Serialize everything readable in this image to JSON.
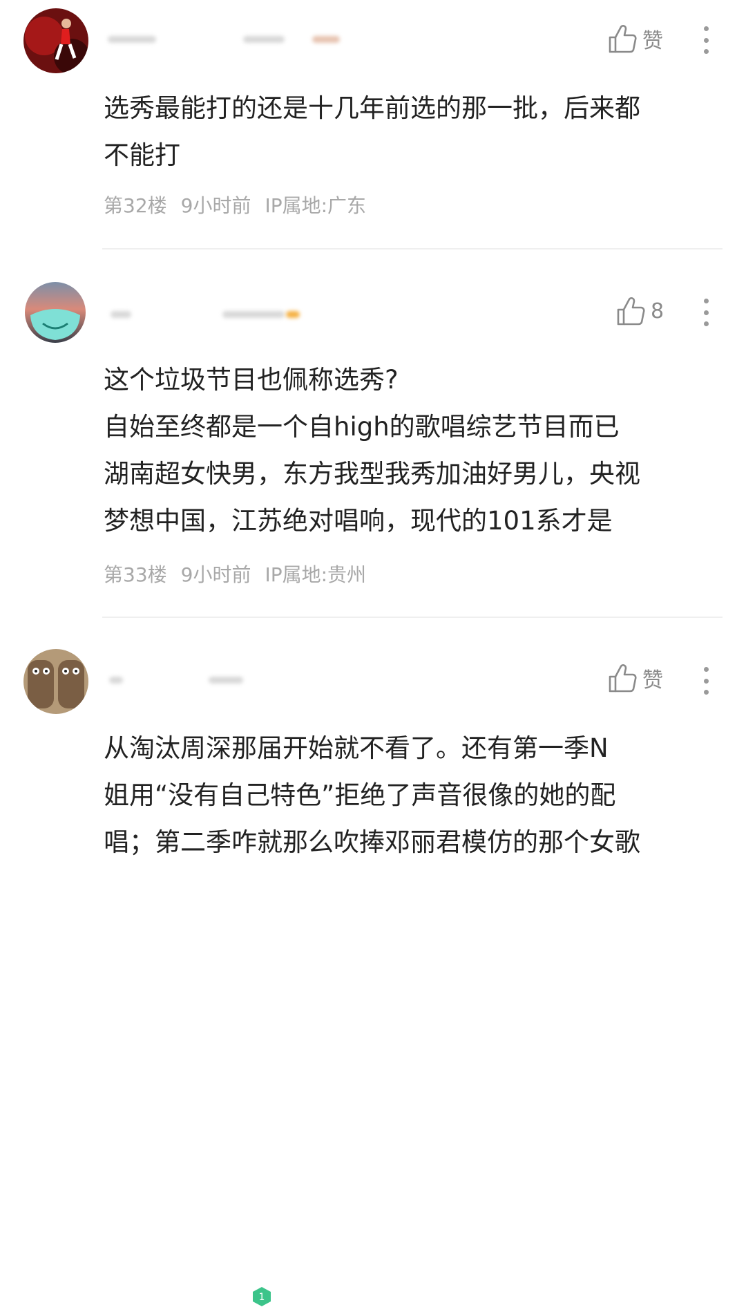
{
  "comments": [
    {
      "like_label": "赞",
      "lines": [
        "选秀最能打的还是十几年前选的那一批，后来都",
        "不能打"
      ],
      "floor": "第32楼",
      "time": "9小时前",
      "ip": "IP属地:广东"
    },
    {
      "like_label": "8",
      "lines": [
        "这个垃圾节目也佩称选秀?",
        "自始至终都是一个自high的歌唱综艺节目而已",
        "湖南超女快男，东方我型我秀加油好男儿，央视",
        "梦想中国，江苏绝对唱响，现代的101系才是"
      ],
      "floor": "第33楼",
      "time": "9小时前",
      "ip": "IP属地:贵州"
    },
    {
      "like_label": "赞",
      "badge": "1",
      "lines": [
        "从淘汰周深那届开始就不看了。还有第一季N",
        "姐用“没有自己特色”拒绝了声音很像的她的配",
        "唱；第二季咋就那么吹捧邓丽君模仿的那个女歌"
      ]
    }
  ],
  "colors": {
    "text": "#222222",
    "meta": "#a8a8a8",
    "badge": "#3cc48a"
  },
  "icons": {
    "like": "thumbs-up-icon",
    "more": "more-vertical-icon"
  }
}
